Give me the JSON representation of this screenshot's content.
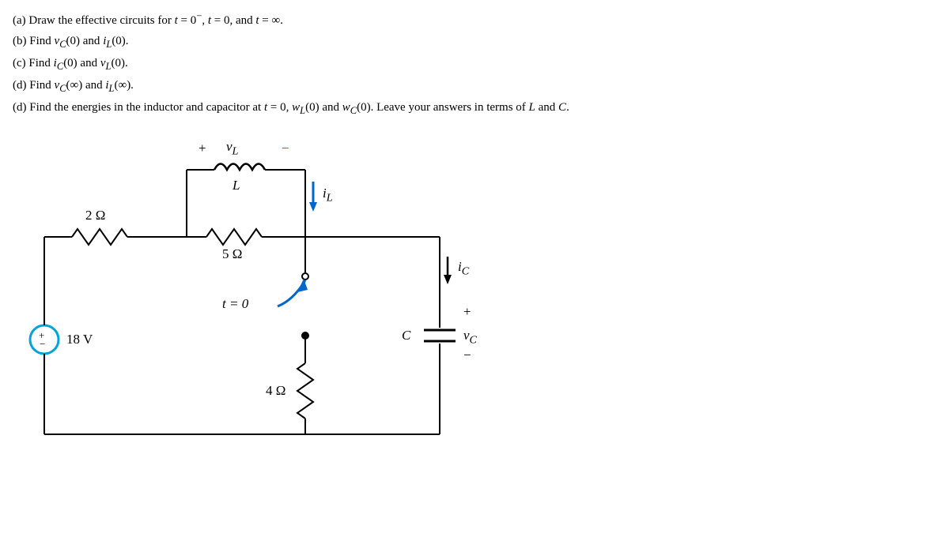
{
  "problems": {
    "a": {
      "label": "(a)",
      "text": "Draw the effective circuits for t = 0⁻, t = 0, and t = ∞."
    },
    "b": {
      "label": "(b)",
      "text": "Find v_C(0) and i_L(0)."
    },
    "c": {
      "label": "(c)",
      "text": "Find i_C(0) and v_L(0)."
    },
    "d": {
      "label": "(d)",
      "text": "Find v_C(∞) and i_L(∞)."
    },
    "e": {
      "label": "(d)",
      "text": "Find the energies in the inductor and capacitor at t = 0, w_L(0) and w_C(0). Leave your answers in terms of L and C."
    }
  },
  "circuit": {
    "source_voltage": "18 V",
    "r1": "2 Ω",
    "r2": "5 Ω",
    "r3": "4 Ω",
    "switch_label": "t = 0",
    "inductor_label": "L",
    "vL_label": "v_L",
    "vL_plus": "+",
    "vL_minus": "−",
    "iL_label": "i_L",
    "capacitor_label": "C",
    "iC_label": "i_C",
    "vC_label": "v_C",
    "vC_plus": "+",
    "vC_minus": "−",
    "source_plus": "+",
    "source_minus": "−"
  }
}
